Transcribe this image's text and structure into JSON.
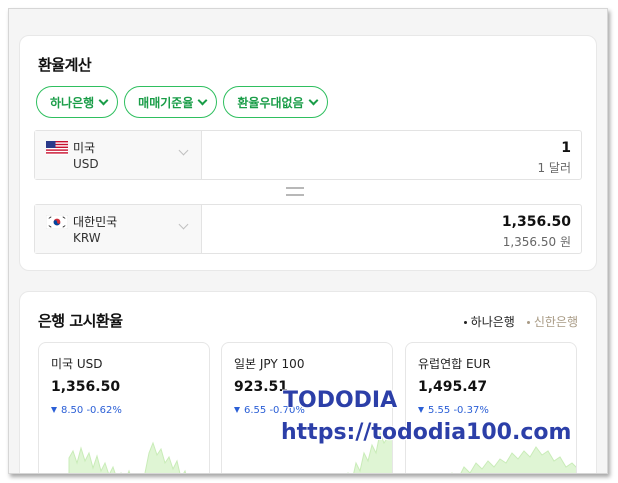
{
  "converter": {
    "title": "환율계산",
    "chips": [
      "하나은행",
      "매매기준율",
      "환율우대없음"
    ],
    "from": {
      "name": "미국",
      "code": "USD",
      "amount": "1",
      "amount_text": "1 달러"
    },
    "to": {
      "name": "대한민국",
      "code": "KRW",
      "amount": "1,356.50",
      "amount_text": "1,356.50 원"
    }
  },
  "bank_rates": {
    "title": "은행 고시환율",
    "banks": [
      {
        "label": "하나은행",
        "active": true
      },
      {
        "label": "신한은행",
        "active": false
      }
    ],
    "cards": [
      {
        "title": "미국 USD",
        "value": "1,356.50",
        "change": "8.50",
        "percent": "-0.62%"
      },
      {
        "title": "일본 JPY 100",
        "value": "923.51",
        "change": "6.55",
        "percent": "-0.70%"
      },
      {
        "title": "유럽연합 EUR",
        "value": "1,495.47",
        "change": "5.55",
        "percent": "-0.37%"
      }
    ]
  },
  "watermark": {
    "line1": "TODODIA",
    "line2": "https://tododia100.com"
  },
  "colors": {
    "accent": "#1a9d48",
    "down": "#2b5fd6",
    "spark": "#dff5d4"
  }
}
